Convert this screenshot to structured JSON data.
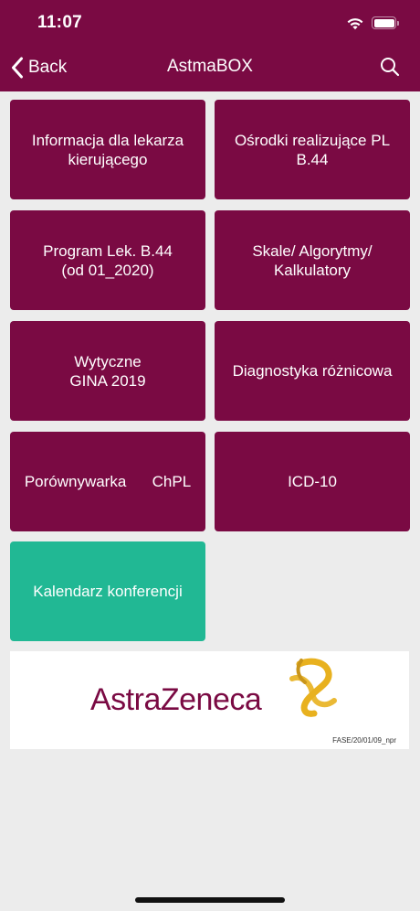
{
  "status_bar": {
    "time": "11:07"
  },
  "nav": {
    "back_label": "Back",
    "title": "AstmaBOX"
  },
  "tiles": [
    {
      "label": "Informacja dla lekarza\nkierującego"
    },
    {
      "label": "Ośrodki realizujące PL\nB.44"
    },
    {
      "label": "Program Lek. B.44\n(od 01_2020)"
    },
    {
      "label": "Skale/ Algorytmy/\nKalkulatory"
    },
    {
      "label": "Wytyczne\nGINA 2019"
    },
    {
      "label": "Diagnostyka różnicowa"
    },
    {
      "label": "Porównywarka      ChPL"
    },
    {
      "label": "ICD-10"
    },
    {
      "label": "Kalendarz konferencji"
    }
  ],
  "banner": {
    "logo_text": "AstraZeneca",
    "code": "FASE/20/01/09_npr"
  },
  "colors": {
    "primary": "#7a0a43",
    "accent_green": "#21b894",
    "background": "#ececec",
    "emblem": "#e8b11f"
  }
}
